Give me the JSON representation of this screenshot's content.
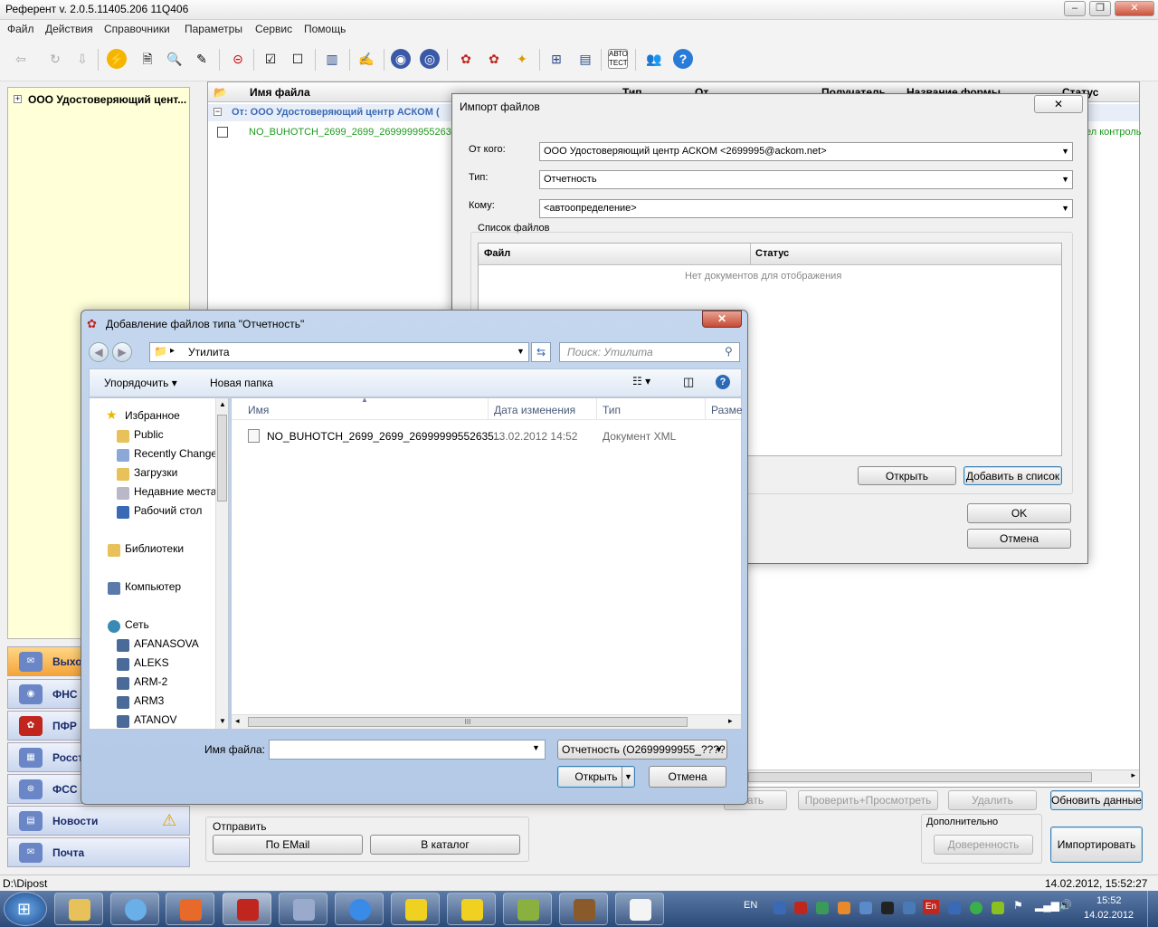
{
  "app": {
    "title": "Референт v. 2.0.5.11405.206 11Q406",
    "menu": [
      "Файл",
      "Действия",
      "Справочники",
      "Параметры",
      "Сервис",
      "Помощь"
    ]
  },
  "tree": {
    "root": "ООО Удостоверяющий цент..."
  },
  "nav": [
    "Выхо",
    "ФНС",
    "ПФР",
    "Росст",
    "ФСС",
    "Новости",
    "Почта"
  ],
  "grid": {
    "headers": [
      "Имя файла",
      "Тип",
      "От",
      "Получатель",
      "Название формы",
      "Статус"
    ],
    "group": "От: ООО Удостоверяющий центр АСКОМ (",
    "row_file": "NO_BUHOTCH_2699_2699_269999995526350",
    "row_status": "ел контроль"
  },
  "bottom": {
    "send_label": "Отправить",
    "email": "По EMail",
    "catalog": "В каталог",
    "extra_label": "Дополнительно",
    "check_view": "Проверить+Просмотреть",
    "delete": "Удалить",
    "refresh": "Обновить данные",
    "power": "Доверенность",
    "import": "Импортировать",
    "partial_btn": "ать"
  },
  "status": {
    "path": "D:\\Dipost",
    "datetime": "14.02.2012, 15:52:27"
  },
  "import_dialog": {
    "title": "Импорт файлов",
    "from_label": "От кого:",
    "from_value": "ООО Удостоверяющий центр АСКОМ <2699995@ackom.net>",
    "type_label": "Тип:",
    "type_value": "Отчетность",
    "to_label": "Кому:",
    "to_value": "<автоопределение>",
    "files_group": "Список файлов",
    "col_file": "Файл",
    "col_status": "Статус",
    "empty": "Нет документов для отображения",
    "open": "Открыть",
    "add": "Добавить в список",
    "ok": "OK",
    "cancel": "Отмена"
  },
  "file_dialog": {
    "title": "Добавление файлов типа \"Отчетность\"",
    "path": "Утилита",
    "search_placeholder": "Поиск: Утилита",
    "organize": "Упорядочить",
    "new_folder": "Новая папка",
    "columns": [
      "Имя",
      "Дата изменения",
      "Тип",
      "Разме"
    ],
    "file": {
      "name": "NO_BUHOTCH_2699_2699_26999999552635...",
      "date": "13.02.2012 14:52",
      "type": "Документ XML"
    },
    "favorites": "Избранное",
    "fav_items": [
      "Public",
      "Recently Change",
      "Загрузки",
      "Недавние места",
      "Рабочий стол"
    ],
    "libraries": "Библиотеки",
    "computer": "Компьютер",
    "network": "Сеть",
    "net_items": [
      "AFANASOVA",
      "ALEKS",
      "ARM-2",
      "ARM3",
      "ATANOV"
    ],
    "filename_label": "Имя файла:",
    "filter": "Отчетность (О2699999955_????",
    "open": "Открыть",
    "cancel": "Отмена",
    "scroll_grip": "III"
  },
  "taskbar": {
    "lang": "EN",
    "lang2": "En",
    "time": "15:52",
    "date": "14.02.2012"
  }
}
